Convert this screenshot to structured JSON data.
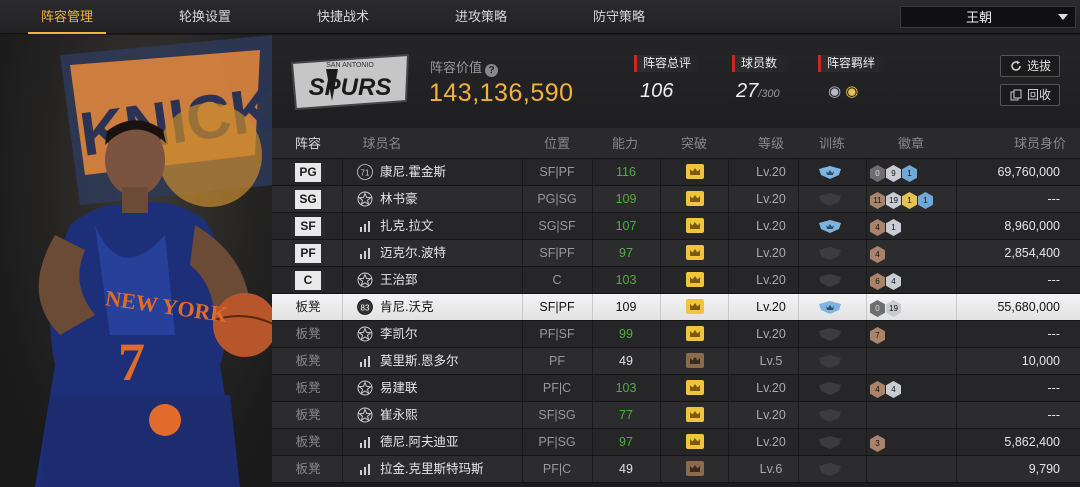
{
  "nav": {
    "tabs": [
      "阵容管理",
      "轮换设置",
      "快捷战术",
      "进攻策略",
      "防守策略"
    ],
    "active_tab": 0,
    "team_select": "王朝"
  },
  "team": {
    "logo_text_top": "SAN ANTONIO",
    "logo_text": "SPURS",
    "value_label": "阵容价值",
    "value": "143,136,590",
    "stats": [
      {
        "label": "阵容总评",
        "value": "106",
        "suffix": ""
      },
      {
        "label": "球员数",
        "value": "27",
        "suffix": "/300"
      },
      {
        "label": "阵容羁绊",
        "value": "",
        "suffix": ""
      }
    ],
    "buttons": [
      "选拔",
      "回收"
    ]
  },
  "table": {
    "headers": [
      "阵容",
      "球员名",
      "位置",
      "能力",
      "突破",
      "等级",
      "训练",
      "徽章",
      "球员身价"
    ],
    "rows": [
      {
        "slot": "PG",
        "starter": true,
        "name": "康尼.霍金斯",
        "icon": "number-71",
        "pos": "SF|PF",
        "ability": "116",
        "ability_color": "green",
        "crown": "gold",
        "level": "Lv.20",
        "train": "blue",
        "badges": [
          [
            "dark",
            "0"
          ],
          [
            "silver",
            "9"
          ],
          [
            "blue",
            "1"
          ]
        ],
        "price": "69,760,000"
      },
      {
        "slot": "SG",
        "starter": true,
        "name": "林书豪",
        "icon": "star",
        "pos": "PG|SG",
        "ability": "109",
        "ability_color": "green",
        "crown": "gold",
        "level": "Lv.20",
        "train": "dark",
        "badges": [
          [
            "brown",
            "11"
          ],
          [
            "silver",
            "19"
          ],
          [
            "gold",
            "1"
          ],
          [
            "blue",
            "1"
          ]
        ],
        "price": "---"
      },
      {
        "slot": "SF",
        "starter": true,
        "name": "扎克.拉文",
        "icon": "bars",
        "pos": "SG|SF",
        "ability": "107",
        "ability_color": "green",
        "crown": "gold",
        "level": "Lv.20",
        "train": "blue",
        "badges": [
          [
            "brown",
            "4"
          ],
          [
            "silver",
            "1"
          ]
        ],
        "price": "8,960,000"
      },
      {
        "slot": "PF",
        "starter": true,
        "name": "迈克尔.波特",
        "icon": "bars",
        "pos": "SF|PF",
        "ability": "97",
        "ability_color": "green",
        "crown": "gold",
        "level": "Lv.20",
        "train": "dark",
        "badges": [
          [
            "brown",
            "4"
          ]
        ],
        "price": "2,854,400"
      },
      {
        "slot": "C",
        "starter": true,
        "name": "王治郅",
        "icon": "star",
        "pos": "C",
        "ability": "103",
        "ability_color": "green",
        "crown": "gold",
        "level": "Lv.20",
        "train": "dark",
        "badges": [
          [
            "brown",
            "6"
          ],
          [
            "silver",
            "4"
          ]
        ],
        "price": "---"
      },
      {
        "slot": "板凳",
        "starter": false,
        "selected": true,
        "name": "肯尼.沃克",
        "icon": "number-83",
        "pos": "SF|PF",
        "ability": "109",
        "ability_color": "white",
        "crown": "gold",
        "level": "Lv.20",
        "train": "blue",
        "badges": [
          [
            "dark",
            "0"
          ],
          [
            "silver",
            "19"
          ]
        ],
        "price": "55,680,000"
      },
      {
        "slot": "板凳",
        "starter": false,
        "name": "李凯尔",
        "icon": "star",
        "pos": "PF|SF",
        "ability": "99",
        "ability_color": "green",
        "crown": "gold",
        "level": "Lv.20",
        "train": "dark",
        "badges": [
          [
            "brown",
            "7"
          ]
        ],
        "price": "---"
      },
      {
        "slot": "板凳",
        "starter": false,
        "name": "莫里斯.恩多尔",
        "icon": "bars",
        "pos": "PF",
        "ability": "49",
        "ability_color": "white",
        "crown": "bronze",
        "level": "Lv.5",
        "train": "dark",
        "badges": [],
        "price": "10,000"
      },
      {
        "slot": "板凳",
        "starter": false,
        "name": "易建联",
        "icon": "star",
        "pos": "PF|C",
        "ability": "103",
        "ability_color": "green",
        "crown": "gold",
        "level": "Lv.20",
        "train": "dark",
        "badges": [
          [
            "brown",
            "4"
          ],
          [
            "silver",
            "4"
          ]
        ],
        "price": "---"
      },
      {
        "slot": "板凳",
        "starter": false,
        "name": "崔永熙",
        "icon": "star",
        "pos": "SF|SG",
        "ability": "77",
        "ability_color": "green",
        "crown": "gold",
        "level": "Lv.20",
        "train": "dark",
        "badges": [],
        "price": "---"
      },
      {
        "slot": "板凳",
        "starter": false,
        "name": "德尼.阿夫迪亚",
        "icon": "bars",
        "pos": "PF|SG",
        "ability": "97",
        "ability_color": "green",
        "crown": "gold",
        "level": "Lv.20",
        "train": "dark",
        "badges": [
          [
            "brown",
            "3"
          ]
        ],
        "price": "5,862,400"
      },
      {
        "slot": "板凳",
        "starter": false,
        "name": "拉金.克里斯特玛斯",
        "icon": "bars",
        "pos": "PF|C",
        "ability": "49",
        "ability_color": "white",
        "crown": "bronze",
        "level": "Lv.6",
        "train": "dark",
        "badges": [],
        "price": "9,790"
      }
    ]
  }
}
